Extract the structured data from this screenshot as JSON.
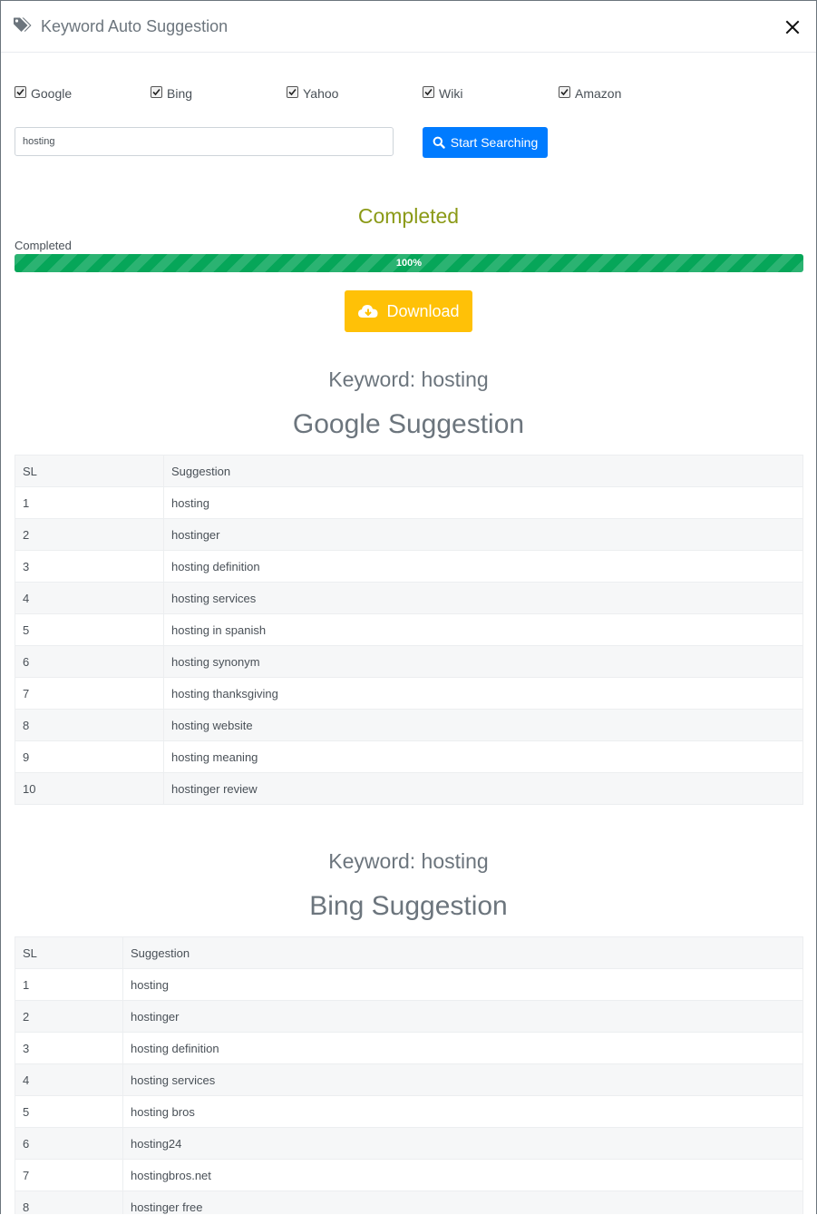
{
  "header": {
    "title": "Keyword Auto Suggestion",
    "close_symbol": "×"
  },
  "engines": [
    {
      "label": "Google",
      "checked": true
    },
    {
      "label": "Bing",
      "checked": true
    },
    {
      "label": "Yahoo",
      "checked": true
    },
    {
      "label": "Wiki",
      "checked": true
    },
    {
      "label": "Amazon",
      "checked": true
    }
  ],
  "search": {
    "value": "hosting",
    "button_label": "Start Searching"
  },
  "status": {
    "heading": "Completed",
    "progress_label": "Completed",
    "progress_text": "100%",
    "progress_fraction": 1.0
  },
  "download": {
    "label": "Download"
  },
  "sections": [
    {
      "keyword_label": "Keyword: hosting",
      "title": "Google Suggestion",
      "columns": [
        "SL",
        "Suggestion"
      ],
      "rows": [
        [
          "1",
          "hosting"
        ],
        [
          "2",
          "hostinger"
        ],
        [
          "3",
          "hosting definition"
        ],
        [
          "4",
          "hosting services"
        ],
        [
          "5",
          "hosting in spanish"
        ],
        [
          "6",
          "hosting synonym"
        ],
        [
          "7",
          "hosting thanksgiving"
        ],
        [
          "8",
          "hosting website"
        ],
        [
          "9",
          "hosting meaning"
        ],
        [
          "10",
          "hostinger review"
        ]
      ]
    },
    {
      "keyword_label": "Keyword: hosting",
      "title": "Bing Suggestion",
      "columns": [
        "SL",
        "Suggestion"
      ],
      "rows": [
        [
          "1",
          "hosting"
        ],
        [
          "2",
          "hostinger"
        ],
        [
          "3",
          "hosting definition"
        ],
        [
          "4",
          "hosting services"
        ],
        [
          "5",
          "hosting bros"
        ],
        [
          "6",
          "hosting24"
        ],
        [
          "7",
          "hostingbros.net"
        ],
        [
          "8",
          "hostinger free"
        ]
      ]
    }
  ],
  "icons": {
    "title": "tags-icon",
    "search": "search-icon",
    "download": "cloud-download-icon",
    "close": "close-icon"
  },
  "colors": {
    "primary": "#007bff",
    "success": "#06a659",
    "warning": "#ffc107",
    "status_text": "#8b9a17"
  }
}
